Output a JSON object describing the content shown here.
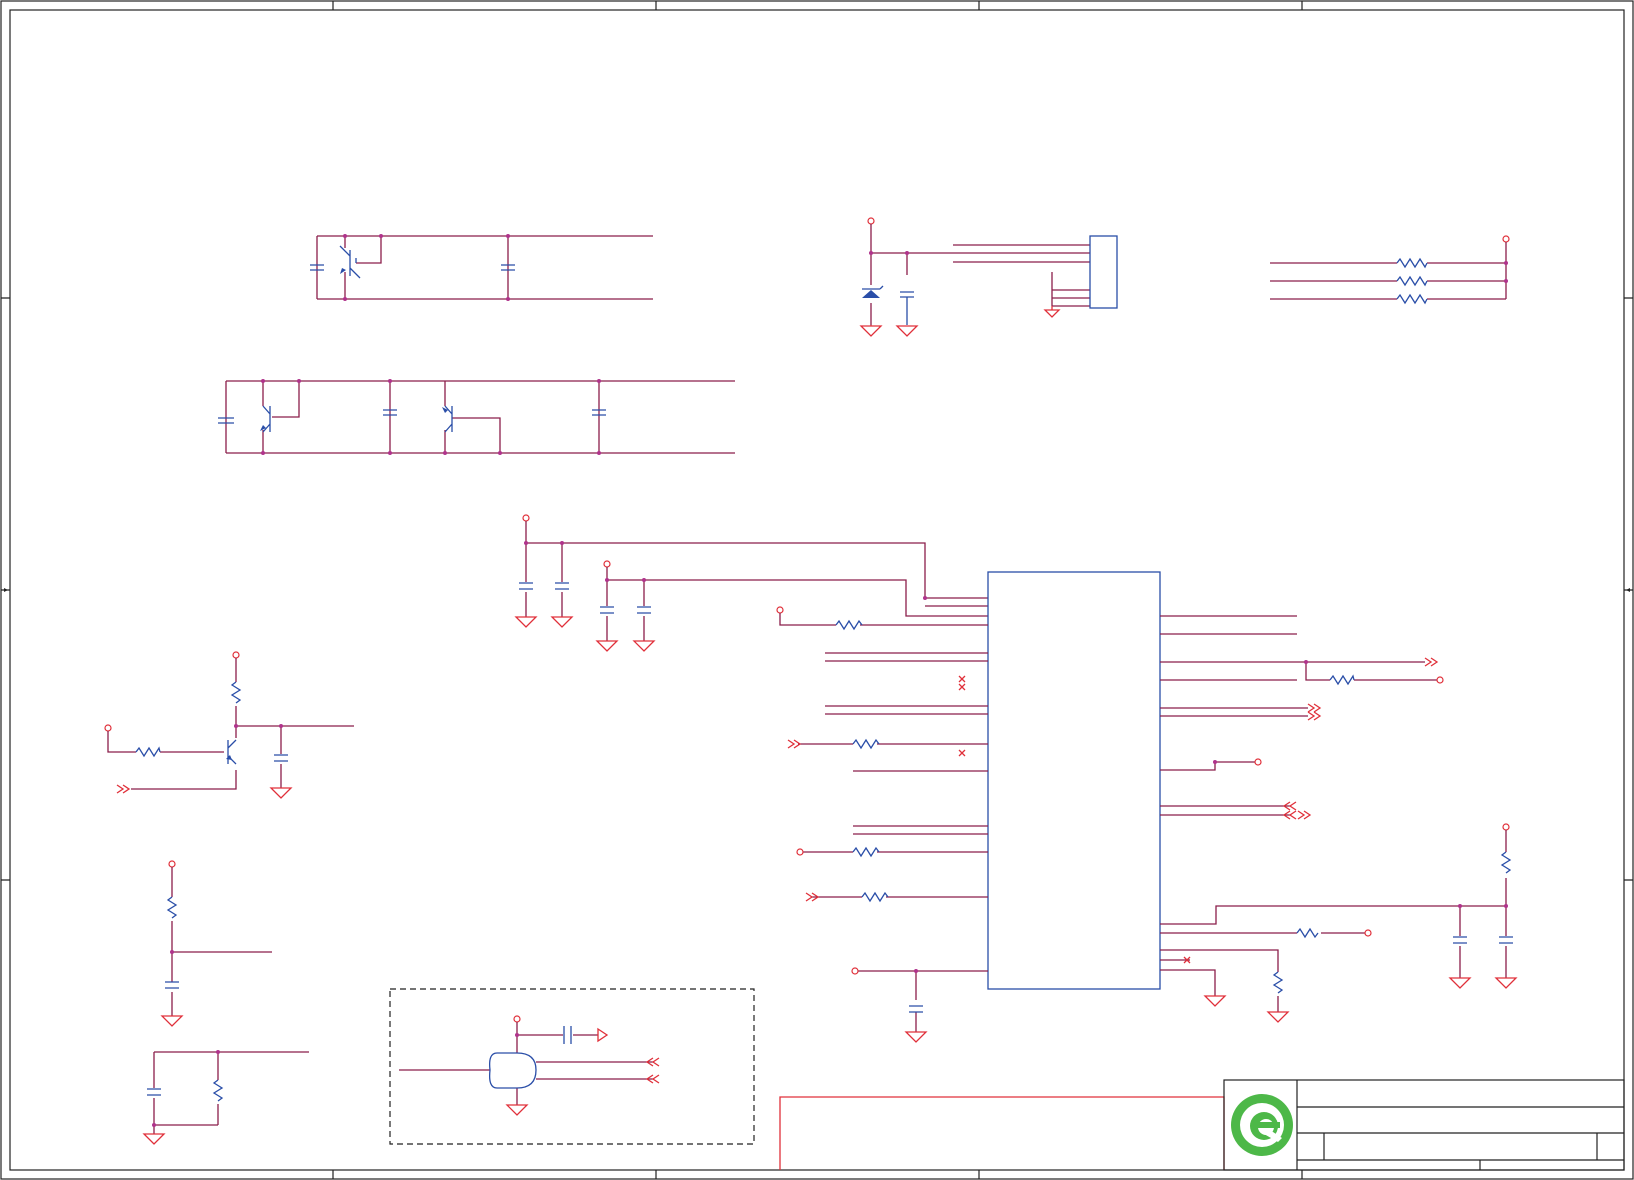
{
  "sheet": {
    "border_color": "#222222",
    "wire_color": "#8b1e4a",
    "symbol_color": "#e0303a",
    "component_color": "#2a4ea8",
    "junction_color": "#b0338c"
  },
  "title_block": {
    "logo": "green-e-logo",
    "logo_color": "#4db848"
  }
}
